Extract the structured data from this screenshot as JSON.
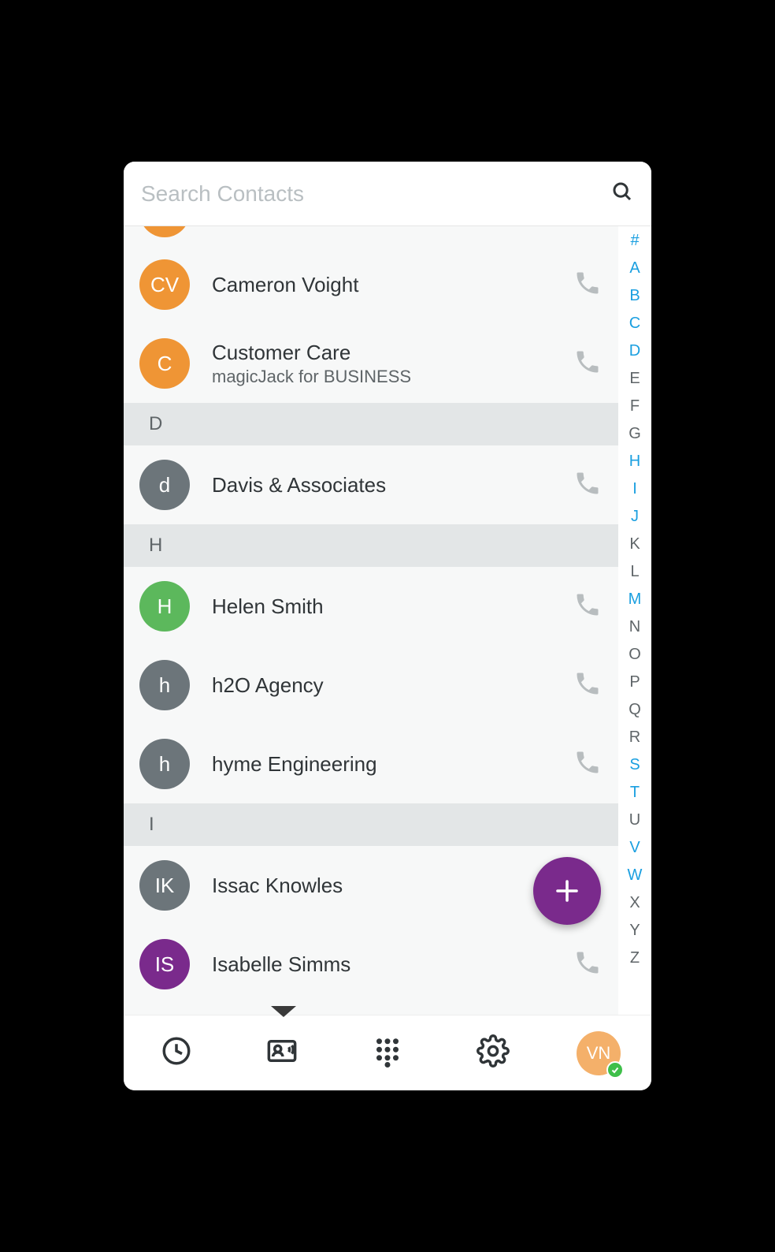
{
  "search": {
    "placeholder": "Search Contacts"
  },
  "partial": {
    "color": "#ef9535"
  },
  "sections": [
    {
      "type": "row",
      "initials": "CV",
      "color": "#ef9535",
      "name": "Cameron Voight"
    },
    {
      "type": "row",
      "initials": "C",
      "color": "#ef9535",
      "name": "Customer Care",
      "sub": "magicJack for BUSINESS"
    },
    {
      "type": "header",
      "label": "D"
    },
    {
      "type": "row",
      "initials": "d",
      "color": "#6c757a",
      "name": "Davis & Associates"
    },
    {
      "type": "header",
      "label": "H"
    },
    {
      "type": "row",
      "initials": "H",
      "color": "#5cb85c",
      "name": "Helen Smith"
    },
    {
      "type": "row",
      "initials": "h",
      "color": "#6c757a",
      "name": "h2O Agency"
    },
    {
      "type": "row",
      "initials": "h",
      "color": "#6c757a",
      "name": "hyme Engineering"
    },
    {
      "type": "header",
      "label": "I"
    },
    {
      "type": "row",
      "initials": "IK",
      "color": "#6c757a",
      "name": "Issac Knowles"
    },
    {
      "type": "row",
      "initials": "IS",
      "color": "#7a2a8c",
      "name": "Isabelle Simms"
    }
  ],
  "alpha": [
    {
      "l": "#",
      "on": true
    },
    {
      "l": "A",
      "on": true
    },
    {
      "l": "B",
      "on": true
    },
    {
      "l": "C",
      "on": true
    },
    {
      "l": "D",
      "on": true
    },
    {
      "l": "E",
      "on": false
    },
    {
      "l": "F",
      "on": false
    },
    {
      "l": "G",
      "on": false
    },
    {
      "l": "H",
      "on": true
    },
    {
      "l": "I",
      "on": true
    },
    {
      "l": "J",
      "on": true
    },
    {
      "l": "K",
      "on": false
    },
    {
      "l": "L",
      "on": false
    },
    {
      "l": "M",
      "on": true
    },
    {
      "l": "N",
      "on": false
    },
    {
      "l": "O",
      "on": false
    },
    {
      "l": "P",
      "on": false
    },
    {
      "l": "Q",
      "on": false
    },
    {
      "l": "R",
      "on": false
    },
    {
      "l": "S",
      "on": true
    },
    {
      "l": "T",
      "on": true
    },
    {
      "l": "U",
      "on": false
    },
    {
      "l": "V",
      "on": true
    },
    {
      "l": "W",
      "on": true
    },
    {
      "l": "X",
      "on": false
    },
    {
      "l": "Y",
      "on": false
    },
    {
      "l": "Z",
      "on": false
    }
  ],
  "profile": {
    "initials": "VN"
  }
}
